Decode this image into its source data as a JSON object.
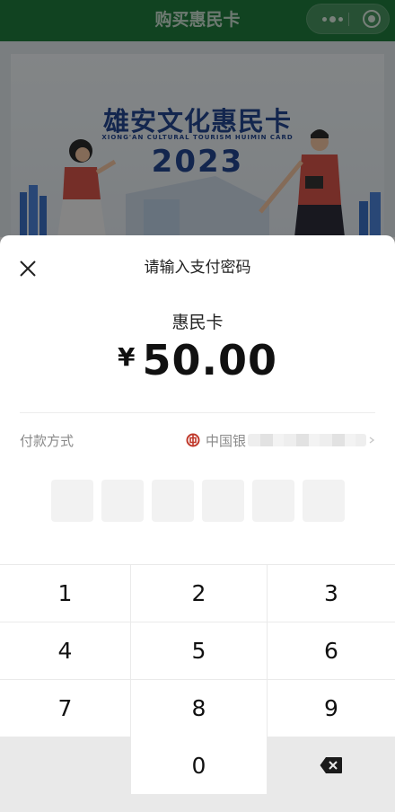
{
  "navbar": {
    "title": "购买惠民卡"
  },
  "banner": {
    "title": "雄安文化惠民卡",
    "subtitle": "XIONG'AN CULTURAL TOURISM HUIMIN CARD",
    "year": "2023"
  },
  "payment": {
    "title": "请输入支付密码",
    "item_name": "惠民卡",
    "currency": "¥",
    "amount": "50.00",
    "method_label": "付款方式",
    "bank_name": "中国银"
  },
  "keypad": {
    "keys": [
      "1",
      "2",
      "3",
      "4",
      "5",
      "6",
      "7",
      "8",
      "9",
      "0"
    ]
  },
  "colors": {
    "navbar": "#1f7a3c",
    "bank_icon": "#c0392b",
    "banner_text": "#23468f"
  }
}
